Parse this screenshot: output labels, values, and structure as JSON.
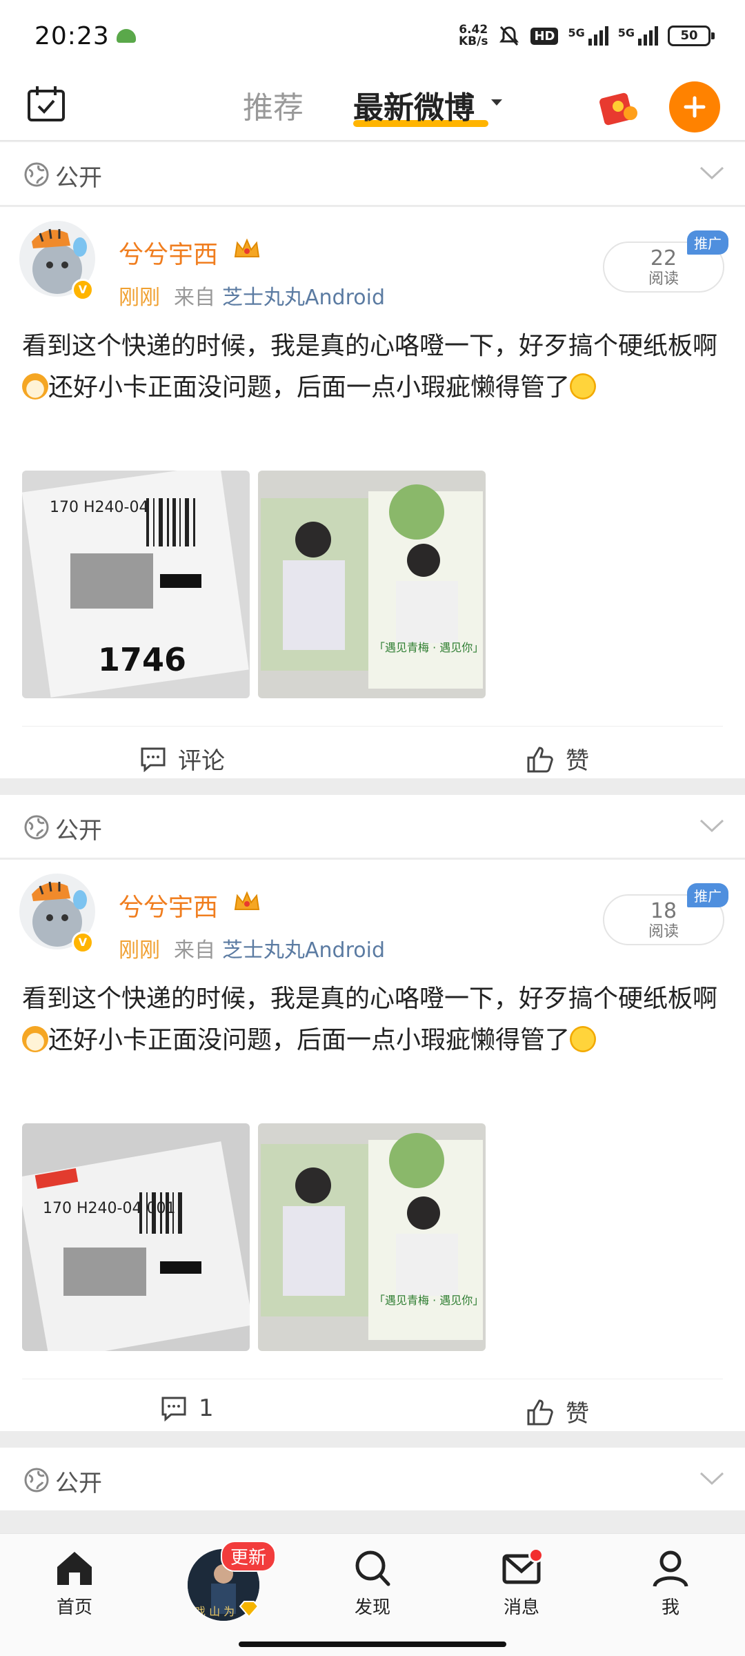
{
  "status_bar": {
    "time": "20:23",
    "net_speed_value": "6.42",
    "net_speed_unit": "KB/s",
    "hd": "HD",
    "signal1": "5G",
    "signal2": "5G",
    "battery": "50"
  },
  "top_nav": {
    "tab_recommend": "推荐",
    "tab_latest": "最新微博",
    "accent_color": "#ff8200"
  },
  "posts": [
    {
      "visibility": "公开",
      "author": "兮兮宇西",
      "time": "刚刚",
      "from_label": "来自",
      "source": "芝士丸丸Android",
      "read_count": "22",
      "read_label": "阅读",
      "ad_label": "推广",
      "text_a": "看到这个快递的时候，我是真的心咯噔一下，好歹搞个硬纸板啊",
      "text_b": "还好小卡正面没问题，后面一点小瑕疵懒得管了",
      "photo1_label": "1746",
      "photo1_code": "170 H240-04",
      "photo2_caption": "「遇见青梅 · 遇见你」",
      "comment_label": "评论",
      "like_label": "赞"
    },
    {
      "visibility": "公开",
      "author": "兮兮宇西",
      "time": "刚刚",
      "from_label": "来自",
      "source": "芝士丸丸Android",
      "read_count": "18",
      "read_label": "阅读",
      "ad_label": "推广",
      "text_a": "看到这个快递的时候，我是真的心咯噔一下，好歹搞个硬纸板啊",
      "text_b": "还好小卡正面没问题，后面一点小瑕疵懒得管了",
      "photo1_label": "",
      "photo1_code": "170 H240-04 001",
      "photo2_caption": "「遇见青梅 · 遇见你」",
      "comment_label": "1",
      "like_label": "赞"
    }
  ],
  "third_visibility": "公开",
  "bottom_nav": {
    "home": "首页",
    "update_badge": "更新",
    "discover": "发现",
    "messages": "消息",
    "me": "我"
  }
}
